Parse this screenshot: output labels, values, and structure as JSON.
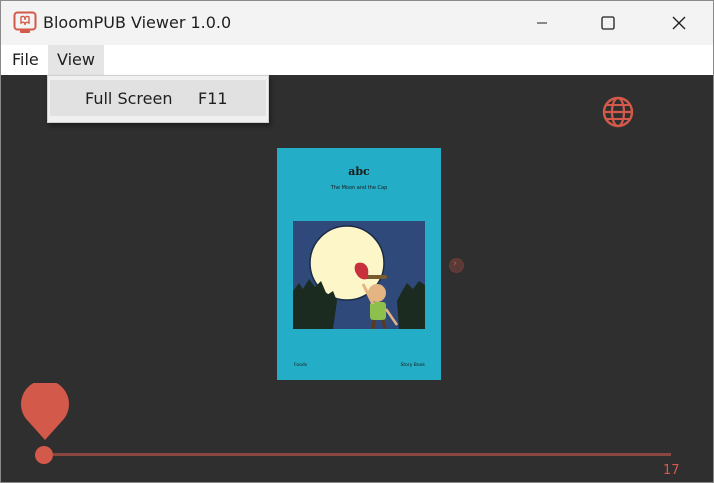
{
  "window": {
    "title": "BloomPUB Viewer 1.0.0",
    "controls": [
      "minimize-icon",
      "maximize-icon",
      "close-icon"
    ]
  },
  "menubar": {
    "items": [
      {
        "label": "File",
        "active": false
      },
      {
        "label": "View",
        "active": true
      }
    ]
  },
  "dropdown": {
    "items": [
      {
        "label": "Full Screen",
        "shortcut": "F11"
      }
    ]
  },
  "toolbar": {
    "language_icon": "globe-icon"
  },
  "book": {
    "title": "abc",
    "subtitle": "The Moon and the Cap",
    "footer_left": "Foods",
    "footer_right": "Story Book"
  },
  "slider": {
    "current_page": 1,
    "total_pages": "17"
  },
  "colors": {
    "accent": "#d35a4a",
    "background": "#2f2f2f",
    "book_cover": "#23adc6",
    "titlebar": "#f3f3f3"
  }
}
